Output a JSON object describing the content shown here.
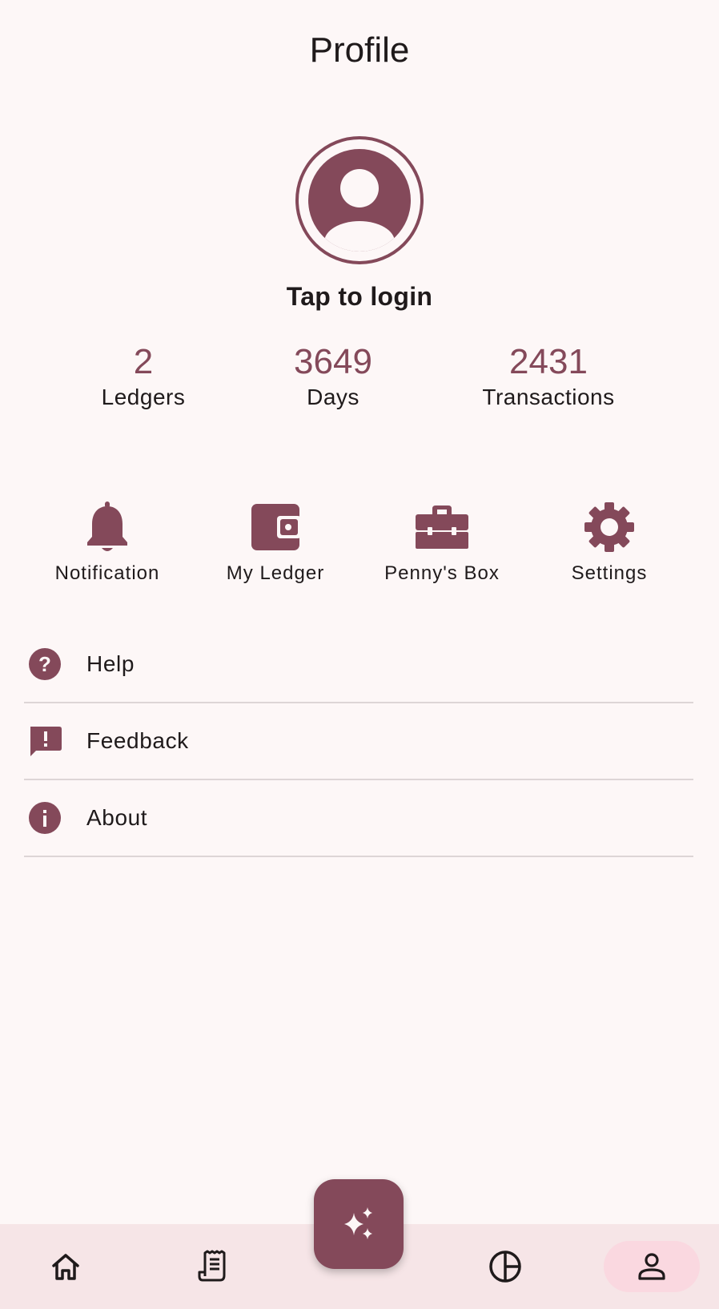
{
  "header": {
    "title": "Profile"
  },
  "profile": {
    "avatar_icon": "account-circle-icon",
    "login_label": "Tap to login"
  },
  "stats": [
    {
      "value": "2",
      "label": "Ledgers"
    },
    {
      "value": "3649",
      "label": "Days"
    },
    {
      "value": "2431",
      "label": "Transactions"
    }
  ],
  "quick_actions": [
    {
      "label": "Notification",
      "icon": "bell-icon"
    },
    {
      "label": "My Ledger",
      "icon": "wallet-icon"
    },
    {
      "label": "Penny's Box",
      "icon": "toolbox-icon"
    },
    {
      "label": "Settings",
      "icon": "gear-icon"
    }
  ],
  "menu": [
    {
      "label": "Help",
      "icon": "help-circle-icon"
    },
    {
      "label": "Feedback",
      "icon": "feedback-icon"
    },
    {
      "label": "About",
      "icon": "info-icon"
    }
  ],
  "fab": {
    "icon": "sparkle-icon"
  },
  "bottom_nav": [
    {
      "icon": "home-icon",
      "active": false
    },
    {
      "icon": "receipt-icon",
      "active": false
    },
    {
      "icon": "pie-chart-icon",
      "active": false
    },
    {
      "icon": "person-icon",
      "active": true
    }
  ],
  "colors": {
    "accent": "#84495a",
    "background": "#fdf7f7",
    "nav_background": "#f6e5e7",
    "active_pill": "#fad8e0",
    "divider": "#ddd5d6",
    "text": "#1f1a1b"
  }
}
